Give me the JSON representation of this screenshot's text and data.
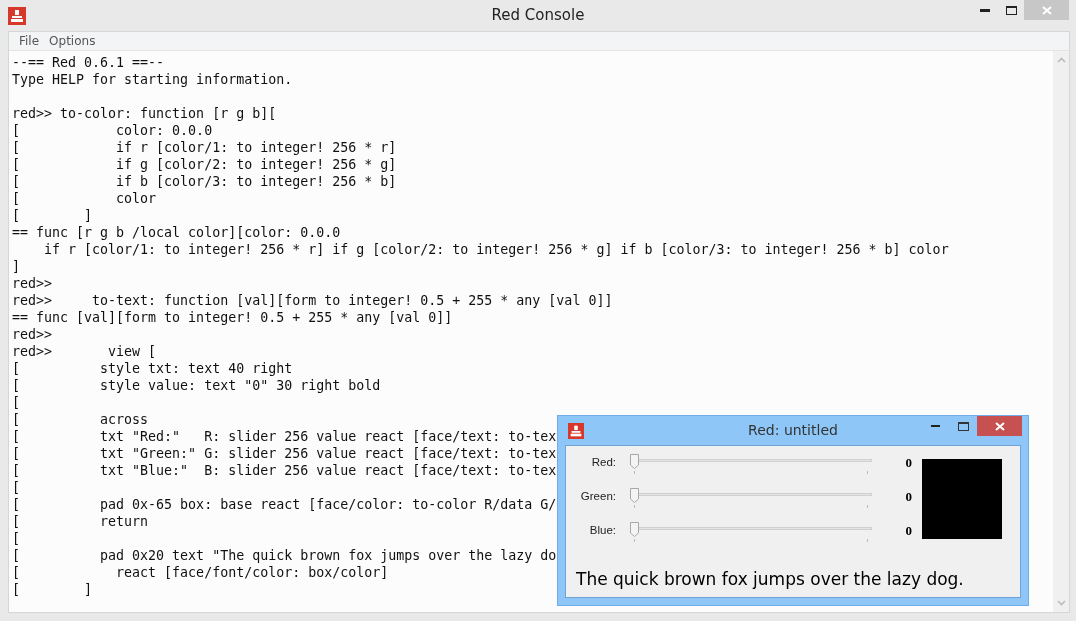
{
  "window": {
    "title": "Red Console"
  },
  "menu": [
    {
      "label": "File"
    },
    {
      "label": "Options"
    }
  ],
  "console": {
    "lines": [
      {
        "kind": "text",
        "text": "--== Red 0.6.1 ==--"
      },
      {
        "kind": "text",
        "text": "Type HELP for starting information."
      },
      {
        "kind": "blank"
      },
      {
        "kind": "text",
        "text": "red>> to-color: function [r g b]["
      },
      {
        "kind": "text",
        "text": "[            color: 0.0.0"
      },
      {
        "kind": "text",
        "text": "[            if r [color/1: to integer! 256 * r]"
      },
      {
        "kind": "text",
        "text": "[            if g [color/2: to integer! 256 * g]"
      },
      {
        "kind": "text",
        "text": "[            if b [color/3: to integer! 256 * b]"
      },
      {
        "kind": "text",
        "text": "[            color"
      },
      {
        "kind": "text",
        "text": "[        ]"
      },
      {
        "kind": "text",
        "text": "== func [r g b /local color][color: 0.0.0"
      },
      {
        "kind": "text",
        "text": "    if r [color/1: to integer! 256 * r] if g [color/2: to integer! 256 * g] if b [color/3: to integer! 256 * b] color"
      },
      {
        "kind": "text",
        "text": "]"
      },
      {
        "kind": "text",
        "text": "red>>"
      },
      {
        "kind": "text",
        "text": "red>>     to-text: function [val][form to integer! 0.5 + 255 * any [val 0]]"
      },
      {
        "kind": "text",
        "text": "== func [val][form to integer! 0.5 + 255 * any [val 0]]"
      },
      {
        "kind": "text",
        "text": "red>>"
      },
      {
        "kind": "text",
        "text": "red>>       view ["
      },
      {
        "kind": "text",
        "text": "[          style txt: text 40 right"
      },
      {
        "kind": "text",
        "text": "[          style value: text \"0\" 30 right bold"
      },
      {
        "kind": "text",
        "text": "["
      },
      {
        "kind": "text",
        "text": "[          across"
      },
      {
        "kind": "text",
        "text": "[          txt \"Red:\"   R: slider 256 value react [face/text: to-tex"
      },
      {
        "kind": "text",
        "text": "[          txt \"Green:\" G: slider 256 value react [face/text: to-tex"
      },
      {
        "kind": "text",
        "text": "[          txt \"Blue:\"  B: slider 256 value react [face/text: to-tex"
      },
      {
        "kind": "text",
        "text": "["
      },
      {
        "kind": "text",
        "text": "[          pad 0x-65 box: base react [face/color: to-color R/data G/"
      },
      {
        "kind": "text",
        "text": "[          return"
      },
      {
        "kind": "text",
        "text": "["
      },
      {
        "kind": "text",
        "text": "[          pad 0x20 text \"The quick brown fox jumps over the lazy do"
      },
      {
        "kind": "text",
        "text": "[            react [face/font/color: box/color]"
      },
      {
        "kind": "text",
        "text": "[        ]"
      }
    ]
  },
  "dialog": {
    "title": "Red: untitled",
    "sliders": [
      {
        "label": "Red:",
        "level": 0,
        "value": "0"
      },
      {
        "label": "Green:",
        "level": 0,
        "value": "0"
      },
      {
        "label": "Blue:",
        "level": 0,
        "value": "0"
      }
    ],
    "sample_text": "The quick brown fox jumps over the lazy dog."
  }
}
